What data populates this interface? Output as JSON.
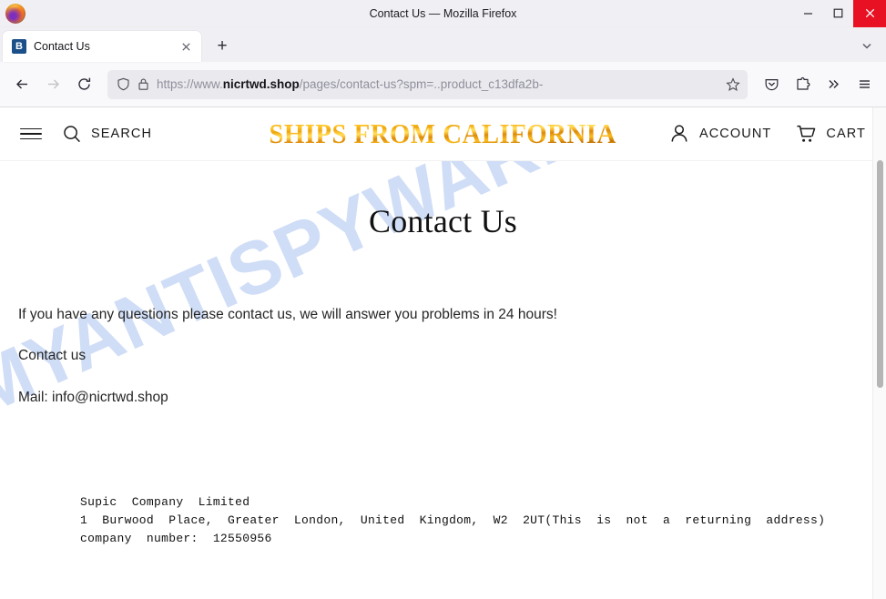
{
  "window": {
    "title": "Contact Us — Mozilla Firefox",
    "logo_icon": "firefox-logo",
    "minimize_label": "—",
    "maximize_label": "□",
    "close_label": "✕"
  },
  "tabstrip": {
    "tabs": [
      {
        "title": "Contact Us",
        "favicon_letter": "B",
        "close_label": "✕"
      }
    ],
    "new_tab_label": "+",
    "list_all_tabs_icon": "chevron-down-icon"
  },
  "toolbar": {
    "back_icon": "back-arrow-icon",
    "forward_icon": "forward-arrow-icon",
    "reload_icon": "reload-icon",
    "shield_icon": "shield-icon",
    "lock_icon": "lock-icon",
    "bookmark_icon": "star-icon",
    "pocket_icon": "pocket-icon",
    "extensions_icon": "extensions-puzzle-icon",
    "overflow_icon": "double-chevron-icon",
    "menu_icon": "hamburger-menu-icon",
    "url": {
      "scheme": "https://www.",
      "host": "nicrtwd.shop",
      "path": "/pages/contact-us?spm=..product_c13dfa2b-"
    }
  },
  "site_header": {
    "menu_icon": "hamburger-menu-icon",
    "search_icon": "search-icon",
    "search_label": "SEARCH",
    "logo_text": "SHIPS FROM CALIFORNIA",
    "account_icon": "user-icon",
    "account_label": "ACCOUNT",
    "cart_icon": "shopping-cart-icon",
    "cart_label": "CART"
  },
  "page": {
    "title": "Contact Us",
    "intro": "If you have any questions please contact us, we will answer you problems in 24 hours!",
    "contact_line": "Contact us",
    "mail_line": "Mail: info@nicrtwd.shop",
    "address": "Supic  Company  Limited\n1  Burwood  Place,  Greater  London,  United  Kingdom,  W2  2UT(This  is  not  a  returning  address)\ncompany  number:  12550956",
    "watermark": "MYANTISPYWARE.COM"
  },
  "colors": {
    "logo_gold": "#d9a32c",
    "watermark_blue": "#cfddf6",
    "close_red": "#e81123",
    "favicon_blue": "#1b4f8a"
  }
}
